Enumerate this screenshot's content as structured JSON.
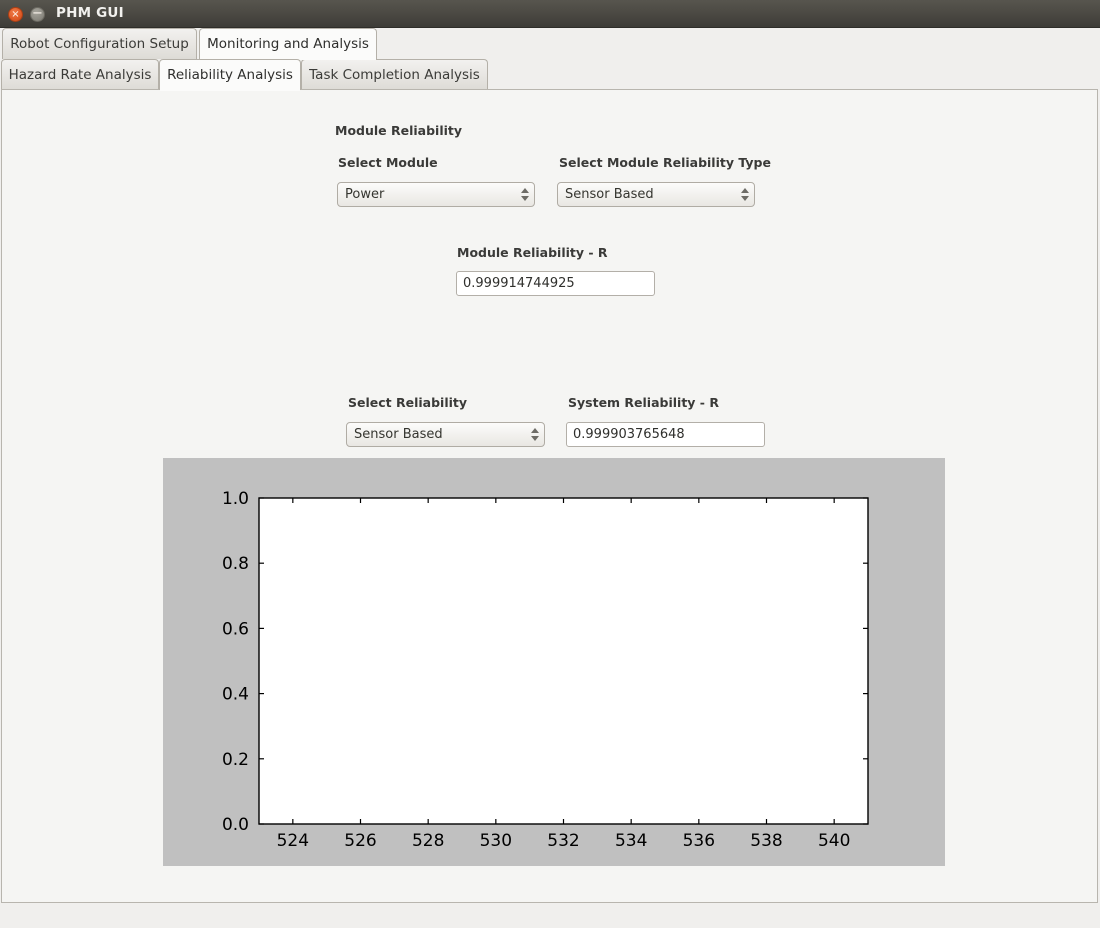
{
  "window": {
    "title": "PHM GUI",
    "close_icon": "close-icon",
    "close_glyph": "×",
    "minimize_icon": "minimize-icon",
    "minimize_glyph": "−"
  },
  "outer_tabs": [
    {
      "id": "robot-config",
      "label": "Robot Configuration Setup",
      "active": false
    },
    {
      "id": "monitoring",
      "label": "Monitoring and Analysis",
      "active": true
    }
  ],
  "inner_tabs": [
    {
      "id": "hazard",
      "label": "Hazard Rate Analysis",
      "active": false
    },
    {
      "id": "reliability",
      "label": "Reliability Analysis",
      "active": true
    },
    {
      "id": "task",
      "label": "Task Completion Analysis",
      "active": false
    }
  ],
  "module_section": {
    "heading": "Module Reliability",
    "select_module_label": "Select Module",
    "select_module_value": "Power",
    "select_type_label": "Select Module Reliability Type",
    "select_type_value": "Sensor Based",
    "result_label": "Module Reliability - R",
    "result_value": "0.999914744925"
  },
  "system_section": {
    "select_reliability_label": "Select Reliability",
    "select_reliability_value": "Sensor Based",
    "result_label": "System Reliability - R",
    "result_value": "0.999903765648"
  },
  "chart_data": {
    "type": "line",
    "title": "",
    "xlabel": "",
    "ylabel": "",
    "xlim": [
      523.0,
      541.0
    ],
    "ylim": [
      0.0,
      1.0
    ],
    "xticks": [
      524,
      526,
      528,
      530,
      532,
      534,
      536,
      538,
      540
    ],
    "xtick_labels": [
      "524",
      "526",
      "528",
      "530",
      "532",
      "534",
      "536",
      "538",
      "540"
    ],
    "yticks": [
      0.0,
      0.2,
      0.4,
      0.6,
      0.8,
      1.0
    ],
    "ytick_labels": [
      "0.0",
      "0.2",
      "0.4",
      "0.6",
      "0.8",
      "1.0"
    ],
    "grid": false,
    "legend": null,
    "series": [],
    "x": [],
    "values": [],
    "figure_facecolor": "#c0c0c0",
    "axes_facecolor": "#ffffff",
    "note": "empty axes - no data plotted"
  }
}
